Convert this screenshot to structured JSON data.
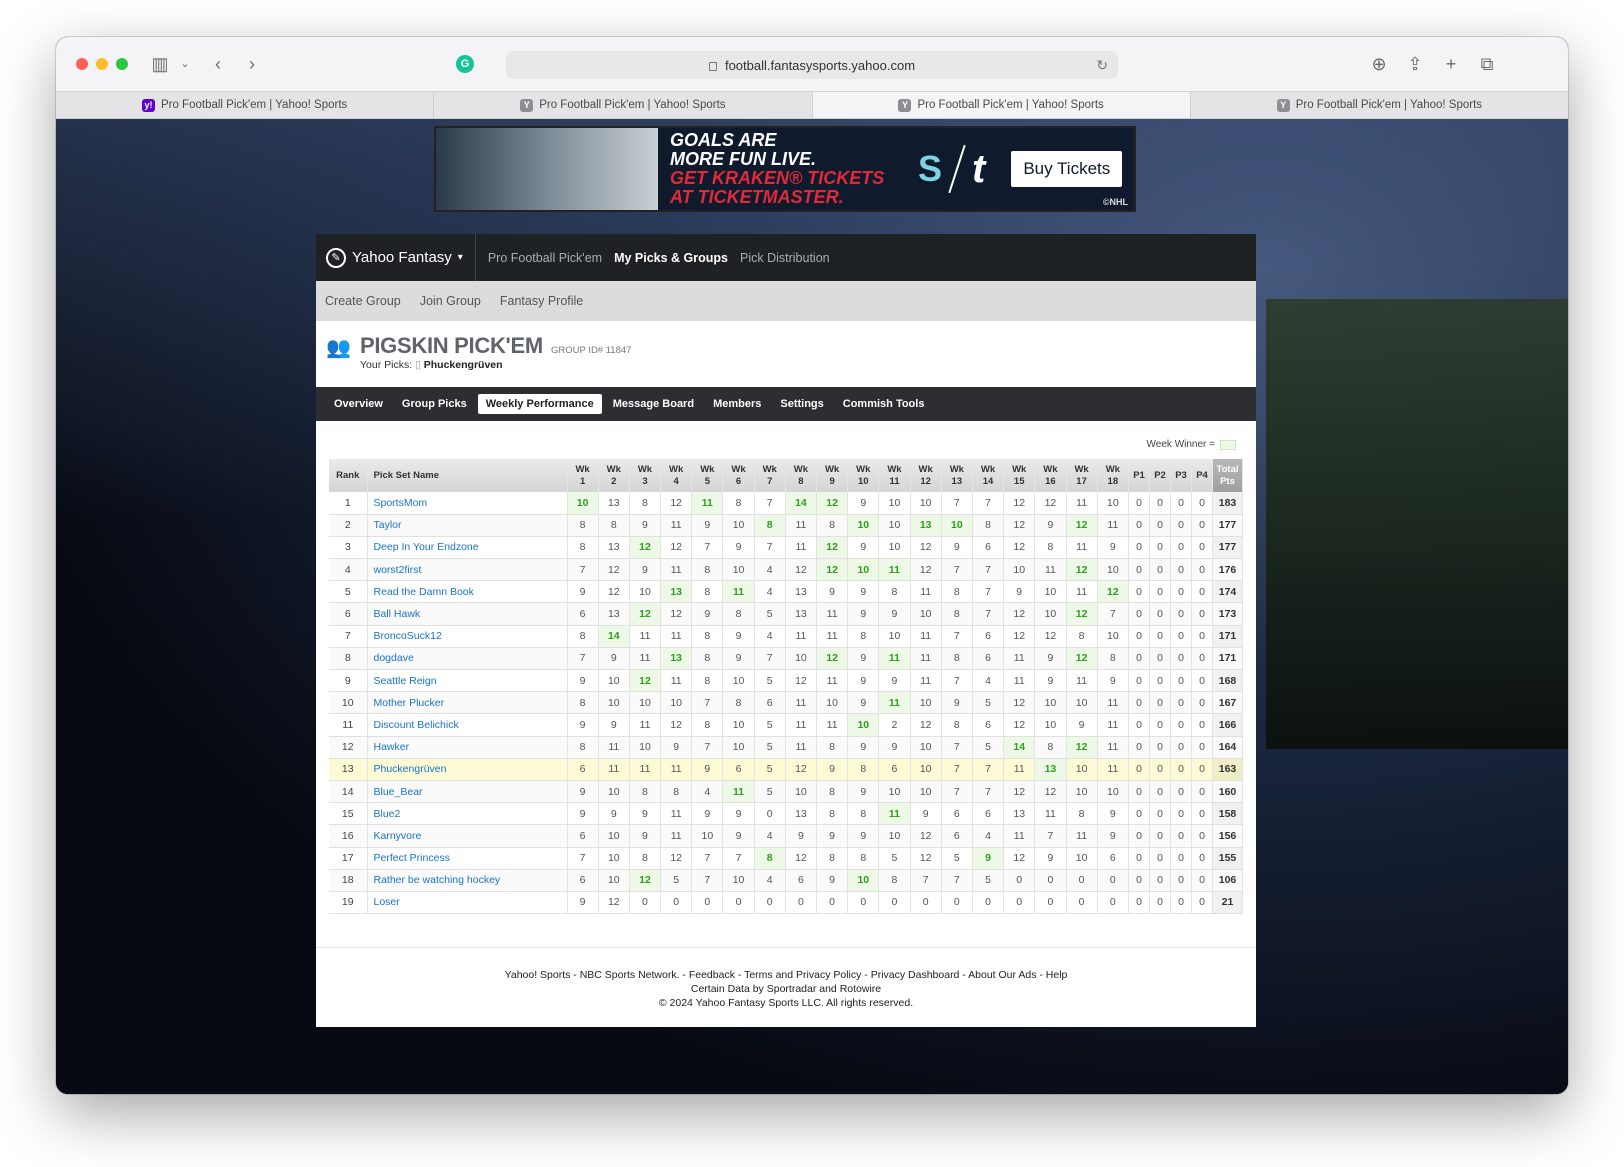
{
  "browser": {
    "url": "football.fantasysports.yahoo.com",
    "tabs": [
      {
        "title": "Pro Football Pick'em | Yahoo! Sports",
        "active": false
      },
      {
        "title": "Pro Football Pick'em | Yahoo! Sports",
        "active": false
      },
      {
        "title": "Pro Football Pick'em | Yahoo! Sports",
        "active": true
      },
      {
        "title": "Pro Football Pick'em | Yahoo! Sports",
        "active": false
      }
    ]
  },
  "ad": {
    "line1": "GOALS ARE",
    "line2": "MORE FUN LIVE.",
    "line3": "GET KRAKEN® TICKETS",
    "line4": "AT TICKETMASTER.",
    "button": "Buy Tickets",
    "credit": "©NHL"
  },
  "nav": {
    "brand": "Yahoo Fantasy",
    "items": [
      "Pro Football Pick'em",
      "My Picks & Groups",
      "Pick Distribution"
    ],
    "active_index": 1
  },
  "subnav": [
    "Create Group",
    "Join Group",
    "Fantasy Profile"
  ],
  "group": {
    "title": "PIGSKIN PICK'EM",
    "group_id": "GROUP ID# 11847",
    "your_picks_label": "Your Picks:",
    "your_picks_value": "Phuckengrüven"
  },
  "group_tabs": [
    "Overview",
    "Group Picks",
    "Weekly Performance",
    "Message Board",
    "Members",
    "Settings",
    "Commish Tools"
  ],
  "legend": "Week Winner =",
  "table": {
    "headers": {
      "rank": "Rank",
      "name": "Pick Set Name",
      "weeks": [
        "1",
        "2",
        "3",
        "4",
        "5",
        "6",
        "7",
        "8",
        "9",
        "10",
        "11",
        "12",
        "13",
        "14",
        "15",
        "16",
        "17",
        "18"
      ],
      "week_prefix": "Wk",
      "playoffs": [
        "P1",
        "P2",
        "P3",
        "P4"
      ],
      "total_top": "Total",
      "total_bottom": "Pts"
    },
    "rows": [
      {
        "rank": "1",
        "name": "SportsMom",
        "weeks": [
          "10",
          "13",
          "8",
          "12",
          "11",
          "8",
          "7",
          "14",
          "12",
          "9",
          "10",
          "10",
          "7",
          "7",
          "12",
          "12",
          "11",
          "10"
        ],
        "wins": [
          0,
          4,
          7,
          8
        ],
        "p": [
          "0",
          "0",
          "0",
          "0"
        ],
        "total": "183"
      },
      {
        "rank": "2",
        "name": "Taylor",
        "weeks": [
          "8",
          "8",
          "9",
          "11",
          "9",
          "10",
          "8",
          "11",
          "8",
          "10",
          "10",
          "13",
          "10",
          "8",
          "12",
          "9",
          "12",
          "11"
        ],
        "wins": [
          6,
          9,
          11,
          12,
          16
        ],
        "p": [
          "0",
          "0",
          "0",
          "0"
        ],
        "total": "177"
      },
      {
        "rank": "3",
        "name": "Deep In Your Endzone",
        "weeks": [
          "8",
          "13",
          "12",
          "12",
          "7",
          "9",
          "7",
          "11",
          "12",
          "9",
          "10",
          "12",
          "9",
          "6",
          "12",
          "8",
          "11",
          "9"
        ],
        "wins": [
          2,
          8
        ],
        "p": [
          "0",
          "0",
          "0",
          "0"
        ],
        "total": "177"
      },
      {
        "rank": "4",
        "name": "worst2first",
        "weeks": [
          "7",
          "12",
          "9",
          "11",
          "8",
          "10",
          "4",
          "12",
          "12",
          "10",
          "11",
          "12",
          "7",
          "7",
          "10",
          "11",
          "12",
          "10"
        ],
        "wins": [
          8,
          9,
          10,
          16
        ],
        "p": [
          "0",
          "0",
          "0",
          "0"
        ],
        "total": "176"
      },
      {
        "rank": "5",
        "name": "Read the Damn Book",
        "weeks": [
          "9",
          "12",
          "10",
          "13",
          "8",
          "11",
          "4",
          "13",
          "9",
          "9",
          "8",
          "11",
          "8",
          "7",
          "9",
          "10",
          "11",
          "12"
        ],
        "wins": [
          3,
          5,
          17
        ],
        "p": [
          "0",
          "0",
          "0",
          "0"
        ],
        "total": "174"
      },
      {
        "rank": "6",
        "name": "Ball Hawk",
        "weeks": [
          "6",
          "13",
          "12",
          "12",
          "9",
          "8",
          "5",
          "13",
          "11",
          "9",
          "9",
          "10",
          "8",
          "7",
          "12",
          "10",
          "12",
          "7"
        ],
        "wins": [
          2,
          16
        ],
        "p": [
          "0",
          "0",
          "0",
          "0"
        ],
        "total": "173"
      },
      {
        "rank": "7",
        "name": "BroncoSuck12",
        "weeks": [
          "8",
          "14",
          "11",
          "11",
          "8",
          "9",
          "4",
          "11",
          "11",
          "8",
          "10",
          "11",
          "7",
          "6",
          "12",
          "12",
          "8",
          "10"
        ],
        "wins": [
          1
        ],
        "p": [
          "0",
          "0",
          "0",
          "0"
        ],
        "total": "171"
      },
      {
        "rank": "8",
        "name": "dogdave",
        "weeks": [
          "7",
          "9",
          "11",
          "13",
          "8",
          "9",
          "7",
          "10",
          "12",
          "9",
          "11",
          "11",
          "8",
          "6",
          "11",
          "9",
          "12",
          "8"
        ],
        "wins": [
          3,
          8,
          10,
          16
        ],
        "p": [
          "0",
          "0",
          "0",
          "0"
        ],
        "total": "171"
      },
      {
        "rank": "9",
        "name": "Seattle Reign",
        "weeks": [
          "9",
          "10",
          "12",
          "11",
          "8",
          "10",
          "5",
          "12",
          "11",
          "9",
          "9",
          "11",
          "7",
          "4",
          "11",
          "9",
          "11",
          "9"
        ],
        "wins": [
          2
        ],
        "p": [
          "0",
          "0",
          "0",
          "0"
        ],
        "total": "168"
      },
      {
        "rank": "10",
        "name": "Mother Plucker",
        "weeks": [
          "8",
          "10",
          "10",
          "10",
          "7",
          "8",
          "6",
          "11",
          "10",
          "9",
          "11",
          "10",
          "9",
          "5",
          "12",
          "10",
          "10",
          "11"
        ],
        "wins": [
          10
        ],
        "p": [
          "0",
          "0",
          "0",
          "0"
        ],
        "total": "167"
      },
      {
        "rank": "11",
        "name": "Discount Belichick",
        "weeks": [
          "9",
          "9",
          "11",
          "12",
          "8",
          "10",
          "5",
          "11",
          "11",
          "10",
          "2",
          "12",
          "8",
          "6",
          "12",
          "10",
          "9",
          "11"
        ],
        "wins": [
          9
        ],
        "p": [
          "0",
          "0",
          "0",
          "0"
        ],
        "total": "166"
      },
      {
        "rank": "12",
        "name": "Hawker",
        "weeks": [
          "8",
          "11",
          "10",
          "9",
          "7",
          "10",
          "5",
          "11",
          "8",
          "9",
          "9",
          "10",
          "7",
          "5",
          "14",
          "8",
          "12",
          "11"
        ],
        "wins": [
          14,
          16
        ],
        "p": [
          "0",
          "0",
          "0",
          "0"
        ],
        "total": "164"
      },
      {
        "rank": "13",
        "name": "Phuckengrüven",
        "weeks": [
          "6",
          "11",
          "11",
          "11",
          "9",
          "6",
          "5",
          "12",
          "9",
          "8",
          "6",
          "10",
          "7",
          "7",
          "11",
          "13",
          "10",
          "11"
        ],
        "wins": [
          15
        ],
        "p": [
          "0",
          "0",
          "0",
          "0"
        ],
        "total": "163",
        "me": true
      },
      {
        "rank": "14",
        "name": "Blue_Bear",
        "weeks": [
          "9",
          "10",
          "8",
          "8",
          "4",
          "11",
          "5",
          "10",
          "8",
          "9",
          "10",
          "10",
          "7",
          "7",
          "12",
          "12",
          "10",
          "10"
        ],
        "wins": [
          5
        ],
        "p": [
          "0",
          "0",
          "0",
          "0"
        ],
        "total": "160"
      },
      {
        "rank": "15",
        "name": "Blue2",
        "weeks": [
          "9",
          "9",
          "9",
          "11",
          "9",
          "9",
          "0",
          "13",
          "8",
          "8",
          "11",
          "9",
          "6",
          "6",
          "13",
          "11",
          "8",
          "9"
        ],
        "wins": [
          10
        ],
        "p": [
          "0",
          "0",
          "0",
          "0"
        ],
        "total": "158"
      },
      {
        "rank": "16",
        "name": "Karnyvore",
        "weeks": [
          "6",
          "10",
          "9",
          "11",
          "10",
          "9",
          "4",
          "9",
          "9",
          "9",
          "10",
          "12",
          "6",
          "4",
          "11",
          "7",
          "11",
          "9"
        ],
        "wins": [],
        "p": [
          "0",
          "0",
          "0",
          "0"
        ],
        "total": "156"
      },
      {
        "rank": "17",
        "name": "Perfect Princess",
        "weeks": [
          "7",
          "10",
          "8",
          "12",
          "7",
          "7",
          "8",
          "12",
          "8",
          "8",
          "5",
          "12",
          "5",
          "9",
          "12",
          "9",
          "10",
          "6"
        ],
        "wins": [
          6,
          13
        ],
        "p": [
          "0",
          "0",
          "0",
          "0"
        ],
        "total": "155"
      },
      {
        "rank": "18",
        "name": "Rather be watching hockey",
        "weeks": [
          "6",
          "10",
          "12",
          "5",
          "7",
          "10",
          "4",
          "6",
          "9",
          "10",
          "8",
          "7",
          "7",
          "5",
          "0",
          "0",
          "0",
          "0"
        ],
        "wins": [
          2,
          9
        ],
        "p": [
          "0",
          "0",
          "0",
          "0"
        ],
        "total": "106"
      },
      {
        "rank": "19",
        "name": "Loser",
        "weeks": [
          "9",
          "12",
          "0",
          "0",
          "0",
          "0",
          "0",
          "0",
          "0",
          "0",
          "0",
          "0",
          "0",
          "0",
          "0",
          "0",
          "0",
          "0"
        ],
        "wins": [],
        "p": [
          "0",
          "0",
          "0",
          "0"
        ],
        "total": "21"
      }
    ]
  },
  "footer": {
    "line1": "Yahoo! Sports - NBC Sports Network. - Feedback - Terms and Privacy Policy - Privacy Dashboard  - About Our Ads - Help",
    "line2": "Certain Data by Sportradar and Rotowire",
    "line3": "© 2024 Yahoo Fantasy Sports LLC. All rights reserved."
  },
  "colors": {
    "link": "#1a73c8",
    "win_text": "#2ea01c",
    "win_bg": "#eef8e6",
    "me_row_bg": "#fdfbd6"
  }
}
